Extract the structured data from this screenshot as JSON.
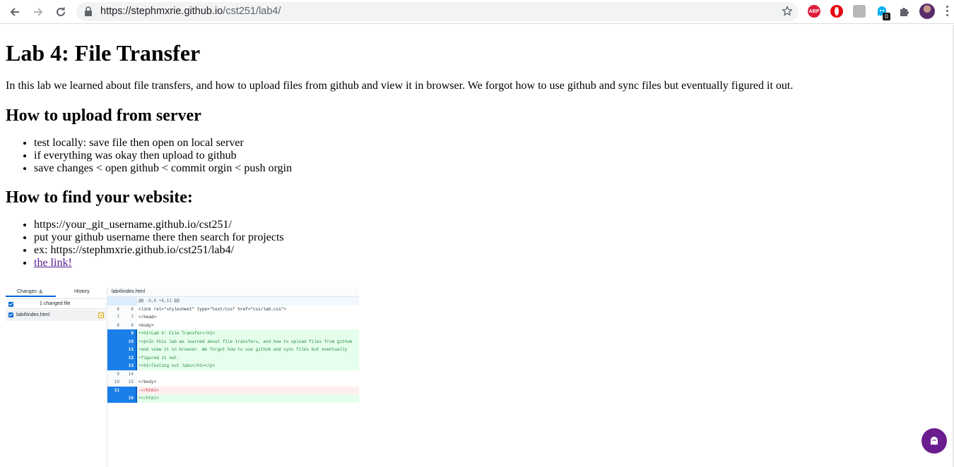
{
  "browser": {
    "url_host": "https://stephmxrie.github.io",
    "url_path": "/cst251/lab4/",
    "extensions": [
      {
        "name": "adblock-plus-icon",
        "label": "ABP"
      },
      {
        "name": "opera-icon",
        "label": ""
      },
      {
        "name": "extension-gray-icon",
        "label": ""
      },
      {
        "name": "ghostery-icon",
        "badge": "0"
      }
    ]
  },
  "page": {
    "title": "Lab 4: File Transfer",
    "intro": "In this lab we learned about file transfers, and how to upload files from github and view it in browser. We forgot how to use github and sync files but eventually figured it out.",
    "section1": {
      "heading": "How to upload from server",
      "items": [
        "test locally: save file then open on local server",
        "if everything was okay then upload to github",
        "save changes < open github < commit orgin < push orgin"
      ]
    },
    "section2": {
      "heading": "How to find your website:",
      "items": [
        "https://your_git_username.github.io/cst251/",
        "put your github username there then search for projects",
        "ex: https://stephmxrie.github.io/cst251/lab4/"
      ],
      "link_text": "the link!"
    }
  },
  "screenshot": {
    "tab_changes": "Changes",
    "tab_changes_count": "1",
    "tab_history": "History",
    "changed_files": "1 changed file",
    "file_name": "lab4\\index.html",
    "header_file": "lab4\\index.html",
    "hunk": "@@ -6,6 +6,11 @@",
    "lines": [
      {
        "type": "ctx",
        "old": "6",
        "new": "6",
        "code": "    <link rel=\"stylesheet\" type=\"text/css\" href=\"css/lab.css\">"
      },
      {
        "type": "ctx",
        "old": "7",
        "new": "7",
        "code": "  </head>"
      },
      {
        "type": "ctx",
        "old": "8",
        "new": "8",
        "code": "  <body>"
      },
      {
        "type": "add",
        "old": "",
        "new": "9",
        "code": "+<h1>Lab 4: File Transfer</h1>"
      },
      {
        "type": "add",
        "old": "",
        "new": "10",
        "code": "+<p>In this lab we learned about file transfers, and how to upload files from github"
      },
      {
        "type": "add",
        "old": "",
        "new": "11",
        "code": "+and view it in browser. We forgot how to use github and sync files but eventually"
      },
      {
        "type": "add",
        "old": "",
        "new": "12",
        "code": "+figured it out."
      },
      {
        "type": "add",
        "old": "",
        "new": "13",
        "code": "+<h1>Testing out labs</h1></p>"
      },
      {
        "type": "ctx",
        "old": "9",
        "new": "14",
        "code": ""
      },
      {
        "type": "ctx",
        "old": "10",
        "new": "15",
        "code": "  </body>"
      },
      {
        "type": "del",
        "old": "11",
        "new": "",
        "code": "-</html>"
      },
      {
        "type": "add",
        "old": "",
        "new": "16",
        "code": "+</html>"
      }
    ]
  }
}
